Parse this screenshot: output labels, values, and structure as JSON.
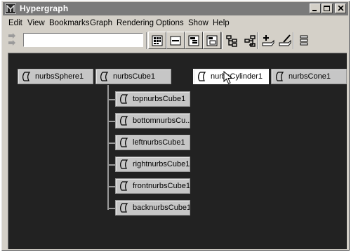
{
  "window": {
    "title": "Hypergraph"
  },
  "menu": [
    "Edit",
    "View",
    "Bookmarks",
    "Graph",
    "Rendering",
    "Options",
    "Show",
    "Help"
  ],
  "toolbar": {
    "tools": [
      "frame-all-icon",
      "frame-selection-icon",
      "scene-hierarchy-icon",
      "input-output-icon",
      "graph-up-icon",
      "graph-down-icon",
      "add-bookmark-icon",
      "edit-icon",
      "list-icon"
    ]
  },
  "nodes": {
    "nurbsSphere1": "nurbsSphere1",
    "nurbsCube1": "nurbsCube1",
    "nurbsCylinder1": "nurbsCylinder1",
    "nurbsCone1": "nurbsCone1",
    "children": [
      "topnurbsCube1",
      "bottomnurbsCu...",
      "leftnurbsCube1",
      "rightnurbsCube1",
      "frontnurbsCube1",
      "backnurbsCube1"
    ]
  }
}
